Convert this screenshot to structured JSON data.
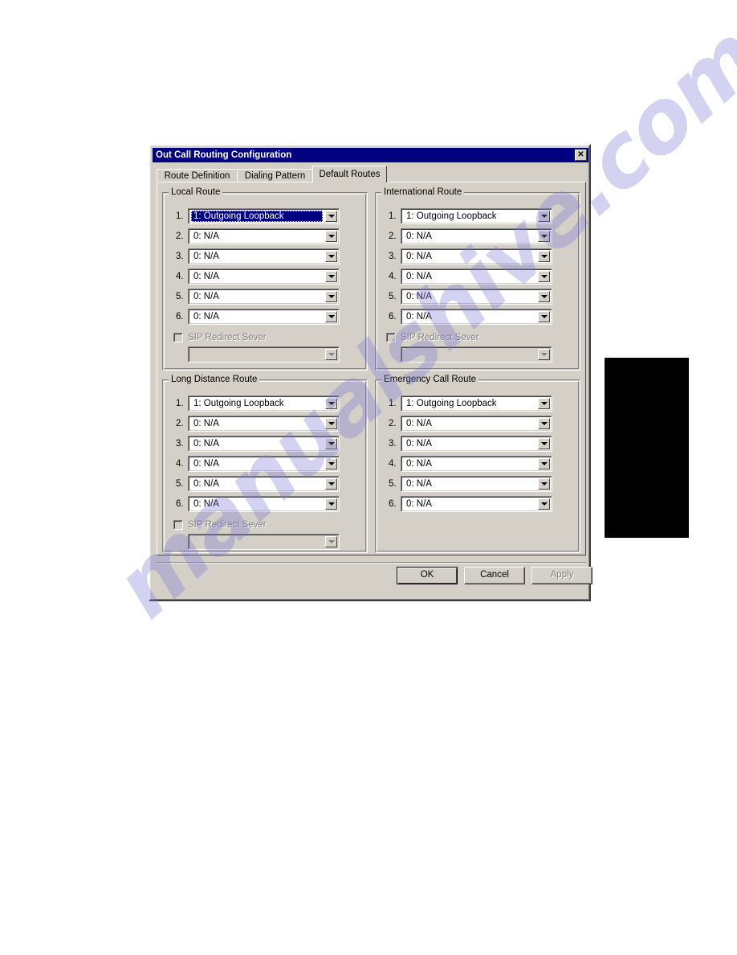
{
  "window": {
    "title": "Out Call Routing Configuration",
    "close_glyph": "✕"
  },
  "tabs": [
    {
      "label": "Route Definition",
      "active": false
    },
    {
      "label": "Dialing Pattern",
      "active": false
    },
    {
      "label": "Default Routes",
      "active": true
    }
  ],
  "groups": [
    {
      "key": "local_route",
      "title": "Local Route",
      "rows": [
        {
          "num": "1.",
          "value": "1: Outgoing Loopback",
          "selected": true
        },
        {
          "num": "2.",
          "value": "0: N/A",
          "selected": false
        },
        {
          "num": "3.",
          "value": "0: N/A",
          "selected": false
        },
        {
          "num": "4.",
          "value": "0: N/A",
          "selected": false
        },
        {
          "num": "5.",
          "value": "0: N/A",
          "selected": false
        },
        {
          "num": "6.",
          "value": "0: N/A",
          "selected": false
        }
      ],
      "sip": {
        "label": "SIP Redirect Sever",
        "checked": false,
        "enabled": false,
        "value": ""
      },
      "has_sip": true
    },
    {
      "key": "international_route",
      "title": "International Route",
      "rows": [
        {
          "num": "1.",
          "value": "1: Outgoing Loopback",
          "selected": false
        },
        {
          "num": "2.",
          "value": "0: N/A",
          "selected": false
        },
        {
          "num": "3.",
          "value": "0: N/A",
          "selected": false
        },
        {
          "num": "4.",
          "value": "0: N/A",
          "selected": false
        },
        {
          "num": "5.",
          "value": "0: N/A",
          "selected": false
        },
        {
          "num": "6.",
          "value": "0: N/A",
          "selected": false
        }
      ],
      "sip": {
        "label": "SIP Redirect Sever",
        "checked": false,
        "enabled": false,
        "value": ""
      },
      "has_sip": true
    },
    {
      "key": "long_distance_route",
      "title": "Long Distance Route",
      "rows": [
        {
          "num": "1.",
          "value": "1: Outgoing Loopback",
          "selected": false
        },
        {
          "num": "2.",
          "value": "0: N/A",
          "selected": false
        },
        {
          "num": "3.",
          "value": "0: N/A",
          "selected": false
        },
        {
          "num": "4.",
          "value": "0: N/A",
          "selected": false
        },
        {
          "num": "5.",
          "value": "0: N/A",
          "selected": false
        },
        {
          "num": "6.",
          "value": "0: N/A",
          "selected": false
        }
      ],
      "sip": {
        "label": "SIP Redirect Sever",
        "checked": false,
        "enabled": false,
        "value": ""
      },
      "has_sip": true
    },
    {
      "key": "emergency_call_route",
      "title": "Emergency Call Route",
      "rows": [
        {
          "num": "1.",
          "value": "1: Outgoing Loopback",
          "selected": false
        },
        {
          "num": "2.",
          "value": "0: N/A",
          "selected": false
        },
        {
          "num": "3.",
          "value": "0: N/A",
          "selected": false
        },
        {
          "num": "4.",
          "value": "0: N/A",
          "selected": false
        },
        {
          "num": "5.",
          "value": "0: N/A",
          "selected": false
        },
        {
          "num": "6.",
          "value": "0: N/A",
          "selected": false
        }
      ],
      "has_sip": false
    }
  ],
  "buttons": {
    "ok": "OK",
    "cancel": "Cancel",
    "apply": "Apply"
  },
  "watermark": {
    "text": "manualshive.com"
  },
  "colors": {
    "titlebar": "#000080",
    "dialog_face": "#d4d0c8",
    "selection": "#000080",
    "disabled_text": "#808080",
    "page_marker": "#000000"
  }
}
